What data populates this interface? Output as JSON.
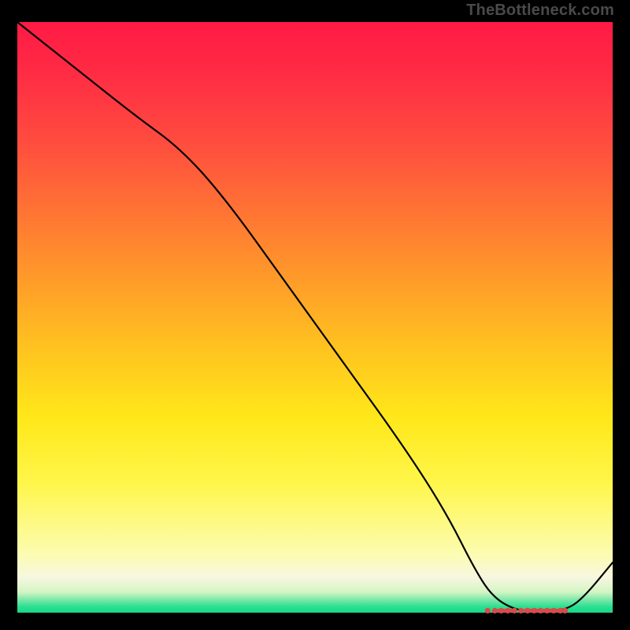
{
  "attribution": "TheBottleneck.com",
  "chart_data": {
    "type": "line",
    "title": "",
    "xlabel": "",
    "ylabel": "",
    "xlim": [
      0,
      100
    ],
    "ylim": [
      0,
      100
    ],
    "gradient_stops": [
      {
        "pos": 0,
        "color": "#ff1a44"
      },
      {
        "pos": 8,
        "color": "#ff2a44"
      },
      {
        "pos": 20,
        "color": "#ff4b3f"
      },
      {
        "pos": 34,
        "color": "#ff7a32"
      },
      {
        "pos": 45,
        "color": "#ffa028"
      },
      {
        "pos": 55,
        "color": "#ffc220"
      },
      {
        "pos": 67,
        "color": "#ffe81a"
      },
      {
        "pos": 78,
        "color": "#fff64a"
      },
      {
        "pos": 90,
        "color": "#fcfcb0"
      },
      {
        "pos": 94,
        "color": "#f7f7e0"
      },
      {
        "pos": 96.5,
        "color": "#d4f5c4"
      },
      {
        "pos": 98,
        "color": "#6fe6a4"
      },
      {
        "pos": 99,
        "color": "#2adf91"
      },
      {
        "pos": 100,
        "color": "#17d886"
      }
    ],
    "series": [
      {
        "name": "bottleneck-curve",
        "x": [
          0,
          10,
          20,
          27.5,
          35,
          45,
          55,
          65,
          72,
          77,
          80,
          84,
          88,
          92,
          95,
          100
        ],
        "values": [
          100,
          92,
          84,
          78.5,
          70,
          56,
          42,
          28,
          17,
          7,
          2.5,
          0.3,
          0.3,
          0.4,
          2.4,
          8.5
        ]
      }
    ],
    "marker_cluster": {
      "name": "optimal-region",
      "y": 0.35,
      "x_range": [
        79,
        92
      ],
      "points_x": [
        79,
        80.2,
        81.3,
        82.4,
        83.5,
        84.6,
        85.7,
        86.8,
        87.9,
        89.0,
        90.1,
        91.2,
        92
      ],
      "dash_segments": [
        [
          80.8,
          82.9
        ],
        [
          85.3,
          87.3
        ],
        [
          88.5,
          90.6
        ]
      ]
    }
  }
}
